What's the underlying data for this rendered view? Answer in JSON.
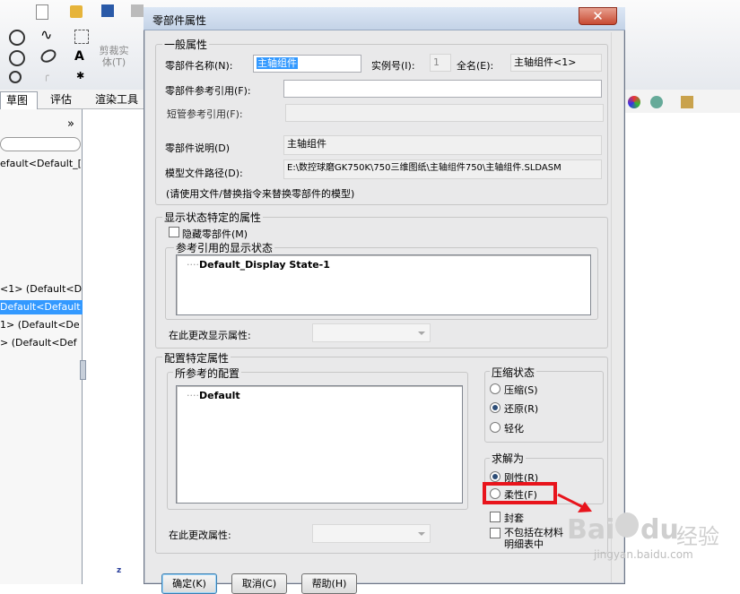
{
  "app": {
    "toolbar": {
      "trim_body_label": "剪裁实体(T)"
    },
    "tabs": [
      {
        "label": "草图"
      },
      {
        "label": "评估"
      },
      {
        "label": "渲染工具"
      }
    ],
    "tree": {
      "collapse_label": "»",
      "items": [
        {
          "text": "efault<Default_["
        },
        {
          "text": "<1> (Default<D"
        },
        {
          "text": "Default<Default"
        },
        {
          "text": "1> (Default<De"
        },
        {
          "text": "> (Default<Def"
        }
      ]
    }
  },
  "dialog": {
    "title": "零部件属性",
    "close_glyph": "✕",
    "general": {
      "legend": "一般属性",
      "name_label": "零部件名称(N):",
      "name_value": "主轴组件",
      "instance_label": "实例号(I):",
      "instance_value": "1",
      "fullname_label": "全名(E):",
      "fullname_value": "主轴组件<1>",
      "ref_label": "零部件参考引用(F):",
      "ref_value": "",
      "short_ref_label": "短管参考引用(F):",
      "short_ref_value": "",
      "desc_label": "零部件说明(D)",
      "desc_value": "主轴组件",
      "path_label": "模型文件路径(D):",
      "path_value": "E:\\数控球磨GK750K\\750三维图纸\\主轴组件750\\主轴组件.SLDASM",
      "note": "(请使用文件/替换指令来替换零部件的模型)"
    },
    "display_state": {
      "legend": "显示状态特定的属性",
      "hide_label": "隐藏零部件(M)",
      "ref_legend": "参考引用的显示状态",
      "items": [
        "Default_Display State-1"
      ],
      "change_label": "在此更改显示属性:",
      "change_value": ""
    },
    "config": {
      "legend": "配置特定属性",
      "ref_legend": "所参考的配置",
      "items": [
        "Default"
      ],
      "suppress_legend": "压缩状态",
      "suppress_options": [
        {
          "label": "压缩(S)",
          "selected": false
        },
        {
          "label": "还原(R)",
          "selected": true
        },
        {
          "label": "轻化",
          "selected": false
        }
      ],
      "solve_legend": "求解为",
      "solve_options": [
        {
          "label": "刚性(R)",
          "selected": true
        },
        {
          "label": "柔性(F)",
          "selected": false
        }
      ],
      "envelope_label": "封套",
      "exclude_label": "不包括在材料明细表中",
      "change_label": "在此更改属性:",
      "change_value": ""
    },
    "buttons": {
      "ok": "确定(K)",
      "cancel": "取消(C)",
      "help": "帮助(H)"
    }
  },
  "overlay": {
    "highlight_color": "#e8141c",
    "watermark_brand": "Bai",
    "watermark_brand_suffix": "du",
    "watermark_cn": "经验",
    "watermark_url": "jingyan.baidu.com"
  }
}
